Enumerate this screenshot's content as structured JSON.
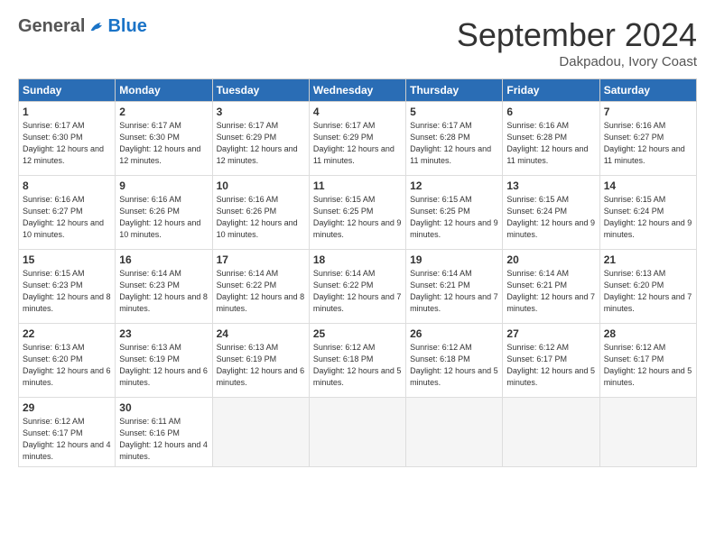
{
  "header": {
    "logo_general": "General",
    "logo_blue": "Blue",
    "month_title": "September 2024",
    "subtitle": "Dakpadou, Ivory Coast"
  },
  "weekdays": [
    "Sunday",
    "Monday",
    "Tuesday",
    "Wednesday",
    "Thursday",
    "Friday",
    "Saturday"
  ],
  "weeks": [
    [
      {
        "day": "1",
        "sunrise": "6:17 AM",
        "sunset": "6:30 PM",
        "daylight": "12 hours and 12 minutes."
      },
      {
        "day": "2",
        "sunrise": "6:17 AM",
        "sunset": "6:30 PM",
        "daylight": "12 hours and 12 minutes."
      },
      {
        "day": "3",
        "sunrise": "6:17 AM",
        "sunset": "6:29 PM",
        "daylight": "12 hours and 12 minutes."
      },
      {
        "day": "4",
        "sunrise": "6:17 AM",
        "sunset": "6:29 PM",
        "daylight": "12 hours and 11 minutes."
      },
      {
        "day": "5",
        "sunrise": "6:17 AM",
        "sunset": "6:28 PM",
        "daylight": "12 hours and 11 minutes."
      },
      {
        "day": "6",
        "sunrise": "6:16 AM",
        "sunset": "6:28 PM",
        "daylight": "12 hours and 11 minutes."
      },
      {
        "day": "7",
        "sunrise": "6:16 AM",
        "sunset": "6:27 PM",
        "daylight": "12 hours and 11 minutes."
      }
    ],
    [
      {
        "day": "8",
        "sunrise": "6:16 AM",
        "sunset": "6:27 PM",
        "daylight": "12 hours and 10 minutes."
      },
      {
        "day": "9",
        "sunrise": "6:16 AM",
        "sunset": "6:26 PM",
        "daylight": "12 hours and 10 minutes."
      },
      {
        "day": "10",
        "sunrise": "6:16 AM",
        "sunset": "6:26 PM",
        "daylight": "12 hours and 10 minutes."
      },
      {
        "day": "11",
        "sunrise": "6:15 AM",
        "sunset": "6:25 PM",
        "daylight": "12 hours and 9 minutes."
      },
      {
        "day": "12",
        "sunrise": "6:15 AM",
        "sunset": "6:25 PM",
        "daylight": "12 hours and 9 minutes."
      },
      {
        "day": "13",
        "sunrise": "6:15 AM",
        "sunset": "6:24 PM",
        "daylight": "12 hours and 9 minutes."
      },
      {
        "day": "14",
        "sunrise": "6:15 AM",
        "sunset": "6:24 PM",
        "daylight": "12 hours and 9 minutes."
      }
    ],
    [
      {
        "day": "15",
        "sunrise": "6:15 AM",
        "sunset": "6:23 PM",
        "daylight": "12 hours and 8 minutes."
      },
      {
        "day": "16",
        "sunrise": "6:14 AM",
        "sunset": "6:23 PM",
        "daylight": "12 hours and 8 minutes."
      },
      {
        "day": "17",
        "sunrise": "6:14 AM",
        "sunset": "6:22 PM",
        "daylight": "12 hours and 8 minutes."
      },
      {
        "day": "18",
        "sunrise": "6:14 AM",
        "sunset": "6:22 PM",
        "daylight": "12 hours and 7 minutes."
      },
      {
        "day": "19",
        "sunrise": "6:14 AM",
        "sunset": "6:21 PM",
        "daylight": "12 hours and 7 minutes."
      },
      {
        "day": "20",
        "sunrise": "6:14 AM",
        "sunset": "6:21 PM",
        "daylight": "12 hours and 7 minutes."
      },
      {
        "day": "21",
        "sunrise": "6:13 AM",
        "sunset": "6:20 PM",
        "daylight": "12 hours and 7 minutes."
      }
    ],
    [
      {
        "day": "22",
        "sunrise": "6:13 AM",
        "sunset": "6:20 PM",
        "daylight": "12 hours and 6 minutes."
      },
      {
        "day": "23",
        "sunrise": "6:13 AM",
        "sunset": "6:19 PM",
        "daylight": "12 hours and 6 minutes."
      },
      {
        "day": "24",
        "sunrise": "6:13 AM",
        "sunset": "6:19 PM",
        "daylight": "12 hours and 6 minutes."
      },
      {
        "day": "25",
        "sunrise": "6:12 AM",
        "sunset": "6:18 PM",
        "daylight": "12 hours and 5 minutes."
      },
      {
        "day": "26",
        "sunrise": "6:12 AM",
        "sunset": "6:18 PM",
        "daylight": "12 hours and 5 minutes."
      },
      {
        "day": "27",
        "sunrise": "6:12 AM",
        "sunset": "6:17 PM",
        "daylight": "12 hours and 5 minutes."
      },
      {
        "day": "28",
        "sunrise": "6:12 AM",
        "sunset": "6:17 PM",
        "daylight": "12 hours and 5 minutes."
      }
    ],
    [
      {
        "day": "29",
        "sunrise": "6:12 AM",
        "sunset": "6:17 PM",
        "daylight": "12 hours and 4 minutes."
      },
      {
        "day": "30",
        "sunrise": "6:11 AM",
        "sunset": "6:16 PM",
        "daylight": "12 hours and 4 minutes."
      },
      null,
      null,
      null,
      null,
      null
    ]
  ]
}
